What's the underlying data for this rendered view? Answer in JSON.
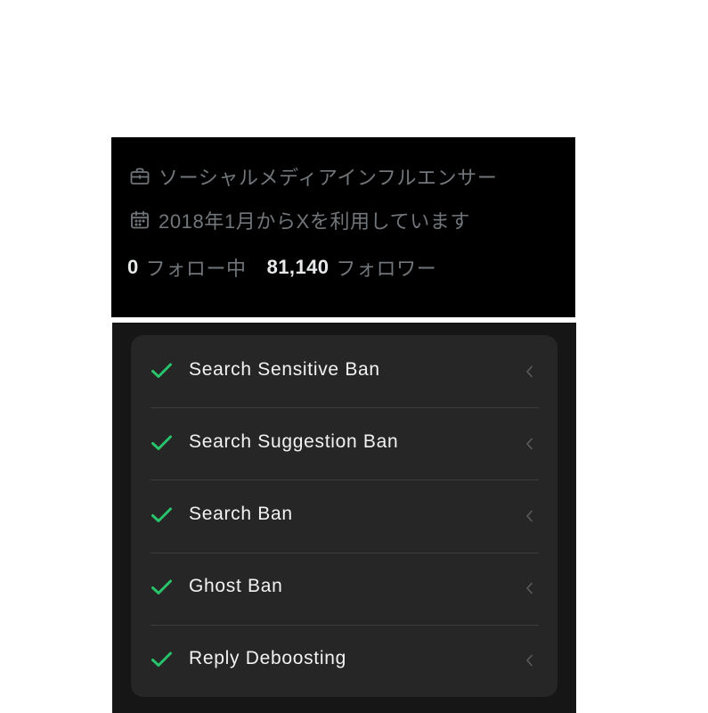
{
  "profile": {
    "occupation": {
      "icon": "briefcase-icon",
      "text": "ソーシャルメディアインフルエンサー"
    },
    "joined": {
      "icon": "calendar-icon",
      "text": "2018年1月からXを利用しています"
    },
    "following": {
      "count": "0",
      "label": "フォロー中"
    },
    "followers": {
      "count": "81,140",
      "label": "フォロワー"
    }
  },
  "ban_checks": {
    "items": [
      {
        "label": "Search Sensitive Ban",
        "icon": "check-icon",
        "action_icon": "chevron-left-icon"
      },
      {
        "label": "Search Suggestion Ban",
        "icon": "check-icon",
        "action_icon": "chevron-left-icon"
      },
      {
        "label": "Search Ban",
        "icon": "check-icon",
        "action_icon": "chevron-left-icon"
      },
      {
        "label": "Ghost Ban",
        "icon": "check-icon",
        "action_icon": "chevron-left-icon"
      },
      {
        "label": "Reply Deboosting",
        "icon": "check-icon",
        "action_icon": "chevron-left-icon"
      }
    ]
  },
  "colors": {
    "profile_background": "#000000",
    "muted_text": "#71767b",
    "primary_text": "#e7e9ea",
    "panel_background": "#161616",
    "card_background": "#262626",
    "check_green": "#27c46b",
    "chevron": "#5c5c5c",
    "divider": "#3d3d3d"
  }
}
